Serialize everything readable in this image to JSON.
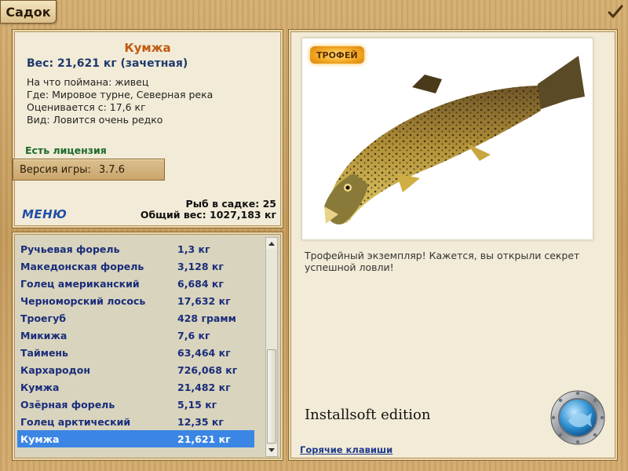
{
  "window": {
    "title": "Садок"
  },
  "fish": {
    "name": "Кумжа",
    "weight": "Вес: 21,621 кг (зачетная)",
    "details": [
      "На что поймана: живец",
      "Где: Мировое турне, Северная река",
      "Оценивается с: 17,6 кг",
      "Вид: Ловится очень редко"
    ],
    "license": "Есть лицензия"
  },
  "version": {
    "label": "Версия игры:",
    "value": "3.7.6"
  },
  "stats": {
    "count": "Рыб в садке: 25",
    "total": "Общий вес: 1027,183 кг"
  },
  "menu": {
    "label": "МЕНЮ"
  },
  "catch_list": [
    {
      "name": "Ручьевая форель",
      "weight": "1,3 кг"
    },
    {
      "name": "Македонская форель",
      "weight": "3,128 кг"
    },
    {
      "name": "Голец американский",
      "weight": "6,684 кг"
    },
    {
      "name": "Черноморский лосось",
      "weight": "17,632 кг"
    },
    {
      "name": "Троегуб",
      "weight": "428 грамм"
    },
    {
      "name": "Микижа",
      "weight": "7,6 кг"
    },
    {
      "name": "Таймень",
      "weight": "63,464 кг"
    },
    {
      "name": "Кархародон",
      "weight": "726,068 кг"
    },
    {
      "name": "Кумжа",
      "weight": "21,482 кг"
    },
    {
      "name": "Озёрная форель",
      "weight": "5,15 кг"
    },
    {
      "name": "Голец арктический",
      "weight": "12,35 кг"
    },
    {
      "name": "Кумжа",
      "weight": "21,621 кг",
      "selected": true
    }
  ],
  "trophy": {
    "badge": "ТРОФЕЙ",
    "description": "Трофейный экземпляр! Кажется, вы открыли секрет успешной ловли!"
  },
  "edition": "Installsoft edition",
  "hotkeys": "Горячие клавиши",
  "colors": {
    "accent_name": "#c25a10",
    "weight_text": "#1f3a6e",
    "license_text": "#1d6a2c",
    "list_text": "#1a2d7a",
    "selection": "#3b86e4"
  },
  "icons": {
    "close": "checkmark-icon",
    "porthole": "porthole-fish-icon",
    "scroll_up": "arrow-up-icon",
    "scroll_down": "arrow-down-icon"
  }
}
